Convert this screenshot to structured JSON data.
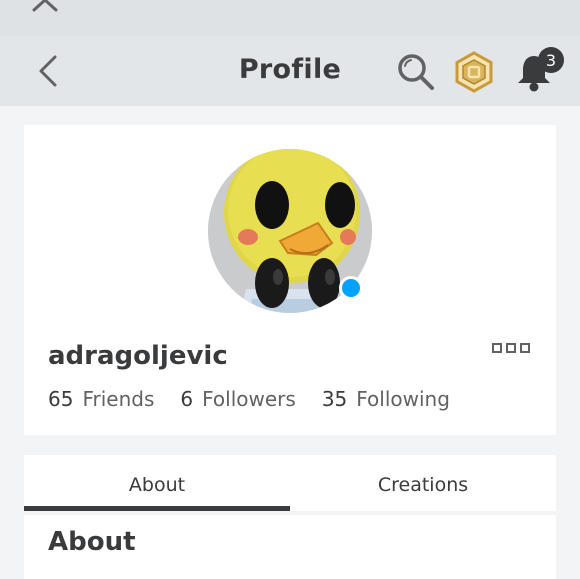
{
  "header": {
    "title": "Profile",
    "notifications_count": "3",
    "icons": {
      "back": "chevron-left-icon",
      "search": "search-icon",
      "robux": "robux-icon",
      "bell": "bell-icon",
      "collapse": "chevron-up-icon"
    }
  },
  "profile": {
    "username": "adragoljevic",
    "online": true,
    "stats": [
      {
        "count": "65",
        "label": "Friends"
      },
      {
        "count": "6",
        "label": "Followers"
      },
      {
        "count": "35",
        "label": "Following"
      }
    ]
  },
  "tabs": [
    {
      "label": "About",
      "active": true
    },
    {
      "label": "Creations",
      "active": false
    }
  ],
  "about": {
    "heading": "About"
  },
  "colors": {
    "presence": "#00a2ff",
    "text": "#393b3d",
    "background": "#f2f4f5",
    "robux_gold": "#d9b45c"
  }
}
